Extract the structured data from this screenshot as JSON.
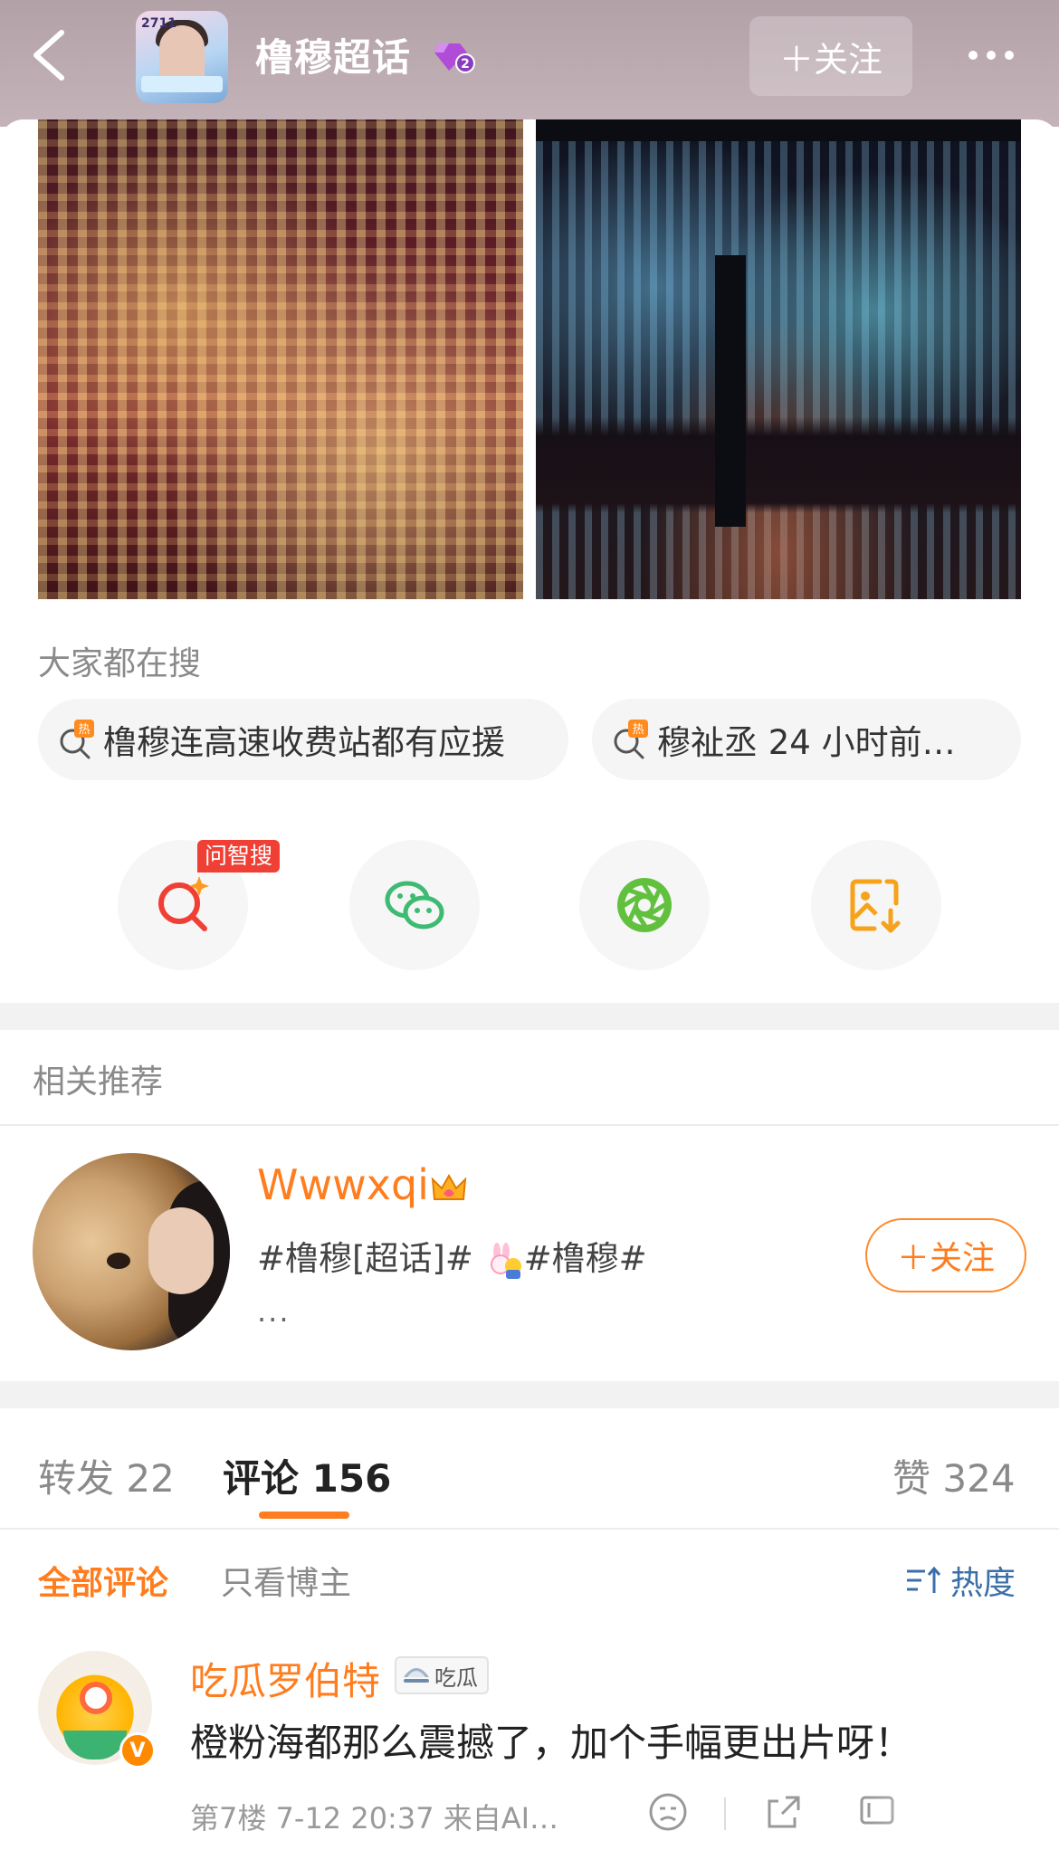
{
  "header": {
    "title": "橹穆超话",
    "level": "2",
    "topic_avatar_text": "2711",
    "follow_label": "＋关注"
  },
  "search_section": {
    "label": "大家都在搜",
    "hot_queries": [
      "橹穆连高速收费站都有应援",
      "穆祉丞 24 小时前…"
    ],
    "hot_icon_text": "热"
  },
  "share_row": {
    "ai_tag": "问智搜",
    "items": [
      "ai-search-icon",
      "wechat-icon",
      "moments-icon",
      "save-image-icon"
    ]
  },
  "recommend": {
    "label": "相关推荐",
    "user": {
      "name": "Wwwxqi",
      "desc_part1": "#橹穆[超话]#",
      "desc_part2": "#橹穆#",
      "desc_more": "...",
      "follow_label": "＋关注"
    }
  },
  "tabs": {
    "repost_label": "转发",
    "repost_count": "22",
    "comment_label": "评论",
    "comment_count": "156",
    "like_label": "赞",
    "like_count": "324"
  },
  "filters": {
    "all": "全部评论",
    "author_only": "只看博主",
    "sort": "热度"
  },
  "comment": {
    "user": "吃瓜罗伯特",
    "badge": "吃瓜",
    "verified": "V",
    "text": "橙粉海都那么震撼了，加个手幅更出片呀！",
    "meta": "第7楼 7-12 20:37 来自AI…"
  },
  "colors": {
    "accent_orange": "#ff7d1e",
    "ai_tag_red": "#f04035",
    "wechat_green": "#3dbb72",
    "moments_green": "#62c03f",
    "save_orange": "#f7a21b"
  }
}
